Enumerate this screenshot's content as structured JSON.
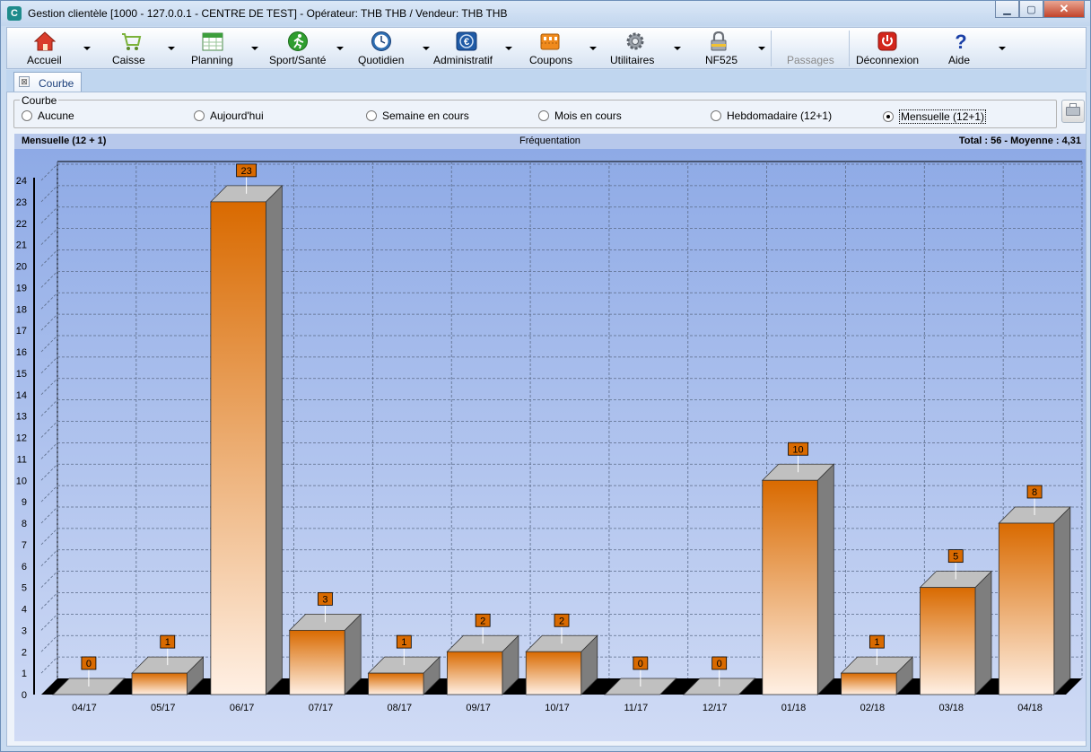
{
  "window": {
    "title": "Gestion clientèle [1000 - 127.0.0.1 - CENTRE DE TEST] - Opérateur: THB THB / Vendeur: THB THB",
    "app_icon_letter": "C",
    "minimize": "▁",
    "maximize": "▢",
    "close": "✕"
  },
  "toolbar": {
    "items": [
      {
        "label": "Accueil",
        "icon": "home-icon",
        "color": "#d93c2c"
      },
      {
        "label": "Caisse",
        "icon": "cart-icon",
        "color": "#7bb23a"
      },
      {
        "label": "Planning",
        "icon": "calendar-icon",
        "color": "#3c9e3c"
      },
      {
        "label": "Sport/Santé",
        "icon": "runner-icon",
        "color": "#2f9e2f"
      },
      {
        "label": "Quotidien",
        "icon": "clock-icon",
        "color": "#2f6fb3"
      },
      {
        "label": "Administratif",
        "icon": "euro-icon",
        "color": "#1f5aa6"
      },
      {
        "label": "Coupons",
        "icon": "coupon-icon",
        "color": "#f08a1c"
      },
      {
        "label": "Utilitaires",
        "icon": "gear-icon",
        "color": "#8a8f98"
      },
      {
        "label": "NF525",
        "icon": "lock-icon",
        "color": "#8a8f98"
      },
      {
        "label": "Passages",
        "icon": "",
        "color": "#8a8a8a"
      },
      {
        "label": "Déconnexion",
        "icon": "power-icon",
        "color": "#d3251b"
      },
      {
        "label": "Aide",
        "icon": "help-icon",
        "color": "#1a3fa6"
      }
    ]
  },
  "tabs": [
    {
      "label": "Courbe",
      "close": "⊠"
    }
  ],
  "curve_group": {
    "legend": "Courbe",
    "options": [
      {
        "label": "Aucune",
        "selected": false
      },
      {
        "label": "Aujourd'hui",
        "selected": false
      },
      {
        "label": "Semaine en cours",
        "selected": false
      },
      {
        "label": "Mois en cours",
        "selected": false
      },
      {
        "label": "Hebdomadaire (12+1)",
        "selected": false
      },
      {
        "label": "Mensuelle (12+1)",
        "selected": true
      }
    ]
  },
  "chart_header": {
    "left": "Mensuelle (12 + 1)",
    "center": "Fréquentation",
    "right": "Total : 56 - Moyenne : 4,31"
  },
  "chart_data": {
    "type": "bar",
    "categories": [
      "04/17",
      "05/17",
      "06/17",
      "07/17",
      "08/17",
      "09/17",
      "10/17",
      "11/17",
      "12/17",
      "01/18",
      "02/18",
      "03/18",
      "04/18"
    ],
    "values": [
      0,
      1,
      23,
      3,
      1,
      2,
      2,
      0,
      0,
      10,
      1,
      5,
      8
    ],
    "title": "Fréquentation",
    "ylim": [
      0,
      24
    ],
    "yticks": [
      "0",
      "1",
      "2",
      "3",
      "4",
      "5",
      "6",
      "7",
      "8",
      "9",
      "10",
      "11",
      "12",
      "13",
      "14",
      "15",
      "16",
      "17",
      "18",
      "19",
      "20",
      "21",
      "22",
      "23",
      "24"
    ],
    "grid": true,
    "style": "3d",
    "colors": {
      "bar_top": "#d96a00",
      "bar_bottom": "#fff0e4",
      "bar_side": "#7e7e7e",
      "bar_cap": "#c0c0c0",
      "label_bg": "#d96a00",
      "background_top": "#8eaae6",
      "background_bottom": "#d0dbf5"
    }
  }
}
